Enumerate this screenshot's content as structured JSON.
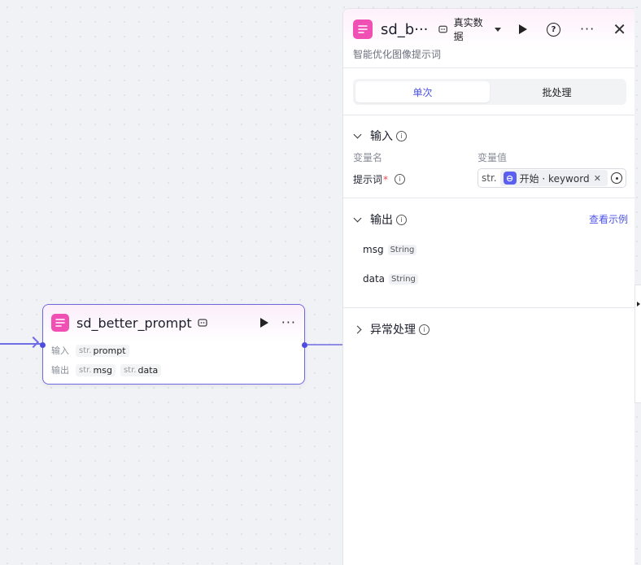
{
  "node": {
    "title": "sd_better_prompt",
    "input_label": "输入",
    "output_label": "输出",
    "inputs": [
      {
        "type": "str.",
        "name": "prompt"
      }
    ],
    "outputs": [
      {
        "type": "str.",
        "name": "msg"
      },
      {
        "type": "str.",
        "name": "data"
      }
    ]
  },
  "panel": {
    "title": "sd_b···",
    "mode": "真实数据",
    "subtitle": "智能优化图像提示词",
    "tabs": [
      {
        "label": "单次",
        "active": true
      },
      {
        "label": "批处理",
        "active": false
      }
    ],
    "input_section": {
      "title": "输入",
      "col_name": "变量名",
      "col_value": "变量值",
      "var_name": "提示词",
      "required_mark": "*",
      "var_type": "str.",
      "ref_text": "开始 · keyword"
    },
    "output_section": {
      "title": "输出",
      "link": "查看示例",
      "items": [
        {
          "name": "msg",
          "type": "String"
        },
        {
          "name": "data",
          "type": "String"
        }
      ]
    },
    "exception_section": {
      "title": "异常处理"
    }
  },
  "colors": {
    "accent": "#4d53e8",
    "app_icon": "#f04fb3",
    "edge": "#6f6ce4"
  }
}
